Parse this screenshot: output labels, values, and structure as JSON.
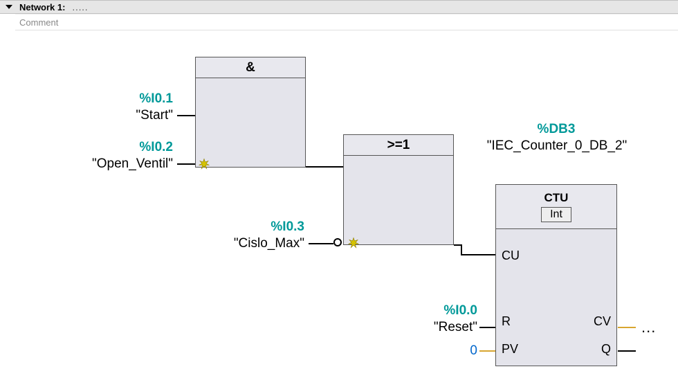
{
  "network": {
    "header_label": "Network 1:",
    "header_dots": ".....",
    "comment_placeholder": "Comment"
  },
  "blocks": {
    "and": {
      "op": "&"
    },
    "or": {
      "op": ">=1"
    },
    "ctu": {
      "title": "CTU",
      "dtype": "Int",
      "instance_addr": "%DB3",
      "instance_sym": "\"IEC_Counter_0_DB_2\"",
      "pins": {
        "cu": "CU",
        "r": "R",
        "pv": "PV",
        "cv": "CV",
        "q": "Q"
      }
    }
  },
  "signals": {
    "start": {
      "addr": "%I0.1",
      "sym": "\"Start\""
    },
    "open_ventil": {
      "addr": "%I0.2",
      "sym": "\"Open_Ventil\""
    },
    "cislo_max": {
      "addr": "%I0.3",
      "sym": "\"Cislo_Max\""
    },
    "reset": {
      "addr": "%I0.0",
      "sym": "\"Reset\""
    }
  },
  "constants": {
    "pv": "0"
  },
  "outputs": {
    "cv_ellipsis": "..."
  }
}
